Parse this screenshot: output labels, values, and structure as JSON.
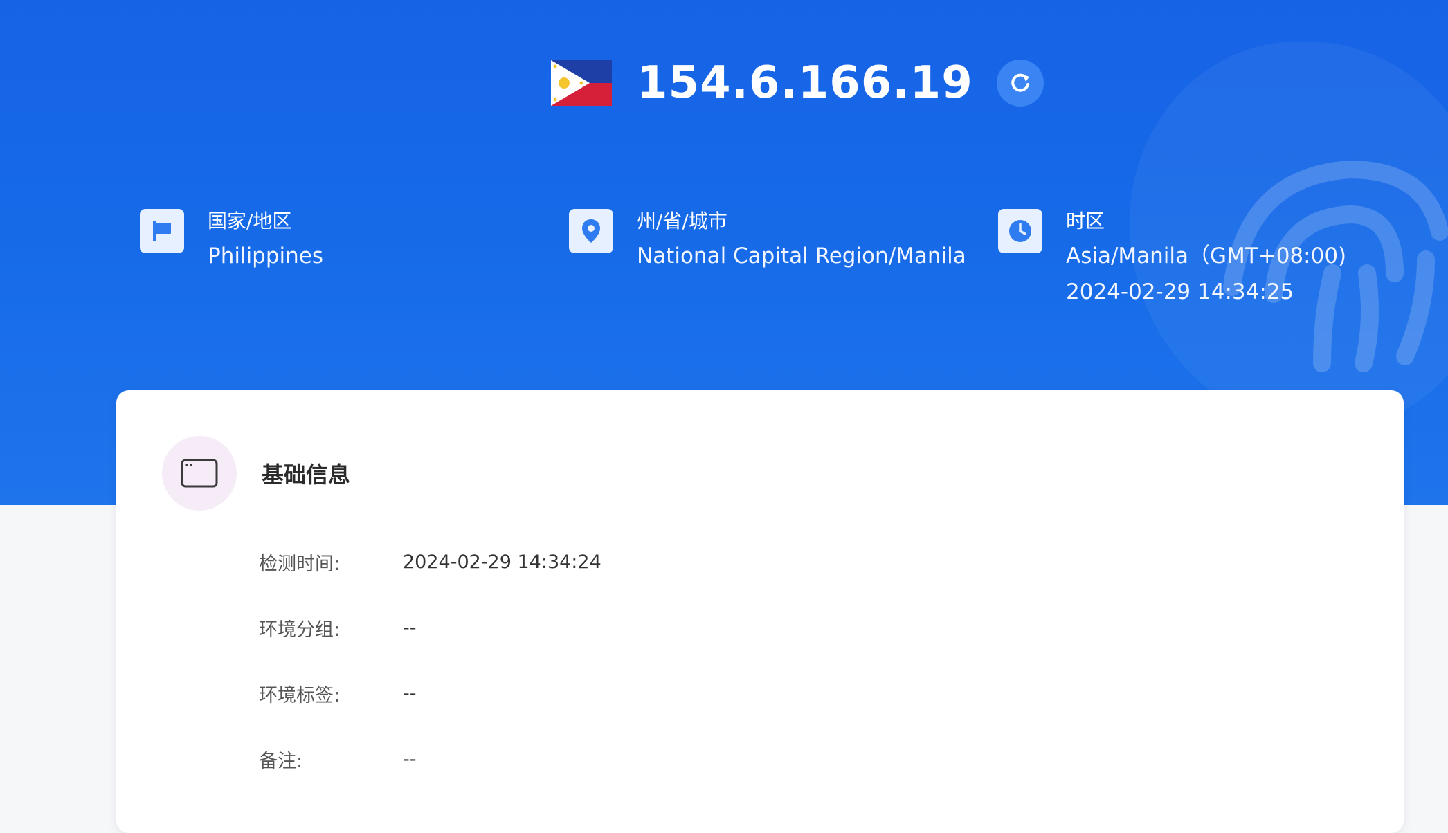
{
  "header": {
    "ip_address": "154.6.166.19",
    "flag_icon": "philippines-flag-icon",
    "refresh_icon": "refresh-icon"
  },
  "location": {
    "country": {
      "label": "国家/地区",
      "value": "Philippines",
      "icon": "flag-icon"
    },
    "region": {
      "label": "州/省/城市",
      "value": "National Capital Region/Manila",
      "icon": "location-pin-icon"
    },
    "timezone": {
      "label": "时区",
      "value": "Asia/Manila（GMT+08:00)",
      "time": "2024-02-29 14:34:25",
      "icon": "clock-icon"
    }
  },
  "basic_info": {
    "title": "基础信息",
    "icon": "browser-window-icon",
    "fields": [
      {
        "label": "检测时间:",
        "value": "2024-02-29 14:34:24"
      },
      {
        "label": "环境分组:",
        "value": "--"
      },
      {
        "label": "环境标签:",
        "value": "--"
      },
      {
        "label": "备注:",
        "value": "--"
      }
    ]
  },
  "colors": {
    "hero_blue": "#1763e6",
    "icon_tile": "#e7f0ff",
    "icon_blue": "#2f7cf0",
    "card_icon_bg": "#f5ecf8",
    "page_bg": "#f6f7f9"
  }
}
